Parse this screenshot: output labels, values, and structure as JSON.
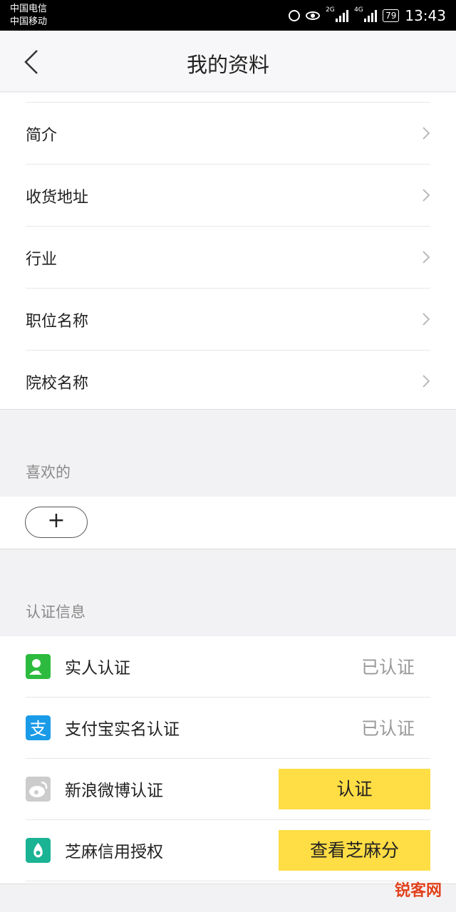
{
  "status_bar": {
    "carrier_1": "中国电信",
    "carrier_2": "中国移动",
    "net_1": "2G",
    "net_2": "4G",
    "battery": "79",
    "time": "13:43"
  },
  "header": {
    "title": "我的资料"
  },
  "profile_items": [
    "简介",
    "收货地址",
    "行业",
    "职位名称",
    "院校名称"
  ],
  "likes": {
    "title": "喜欢的",
    "add_label": "+"
  },
  "verification": {
    "title": "认证信息",
    "items": [
      {
        "label": "实人认证",
        "status": "已认证",
        "icon": "person-verify-icon",
        "color": "#2dbb3f"
      },
      {
        "label": "支付宝实名认证",
        "status": "已认证",
        "icon": "alipay-icon",
        "color": "#1a9be8"
      },
      {
        "label": "新浪微博认证",
        "button": "认证",
        "icon": "weibo-icon",
        "color": "#cccccc"
      },
      {
        "label": "芝麻信用授权",
        "button": "查看芝麻分",
        "icon": "sesame-icon",
        "color": "#1ab394"
      }
    ]
  },
  "watermark": "锐客网",
  "colors": {
    "accent_button": "#ffdd44"
  }
}
